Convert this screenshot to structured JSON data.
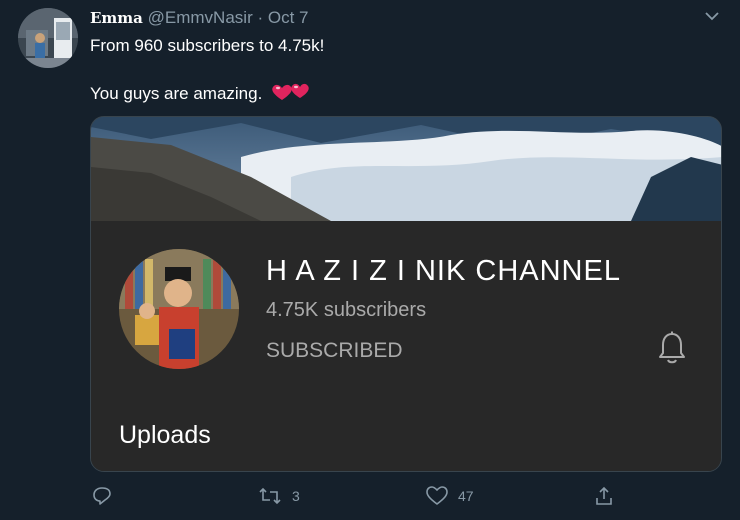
{
  "tweet": {
    "display_name": "Emma",
    "handle": "@EmmvNasir",
    "separator": "·",
    "date": "Oct 7",
    "text_line1": "From 960 subscribers to 4.75k!",
    "text_line2": "You guys are amazing.",
    "hearts_icon": "two-hearts-emoji"
  },
  "card": {
    "channel_name": "H A Z I Z I NIK CHANNEL",
    "subscribers": "4.75K subscribers",
    "subscribe_state": "SUBSCRIBED",
    "uploads_label": "Uploads",
    "bell_icon": "bell-icon"
  },
  "actions": {
    "reply_count": "",
    "retweet_count": "3",
    "like_count": "47",
    "share_label": ""
  },
  "colors": {
    "background": "#15202b",
    "secondary_text": "#8899a6",
    "card_background": "#282828",
    "heart_red": "#e0245e"
  }
}
